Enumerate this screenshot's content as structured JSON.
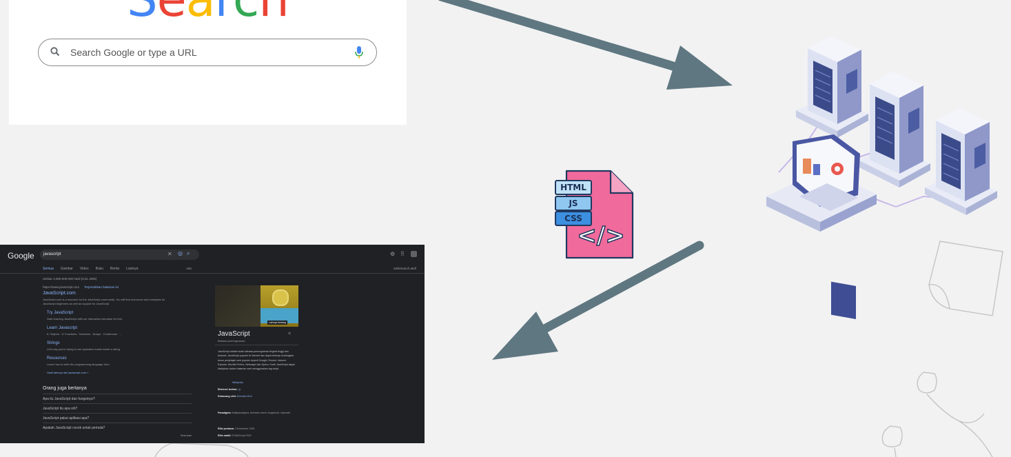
{
  "search_card": {
    "logo_letters": [
      {
        "ch": "S",
        "color": "#4285f4"
      },
      {
        "ch": "e",
        "color": "#ea4335"
      },
      {
        "ch": "a",
        "color": "#fbbc05"
      },
      {
        "ch": "r",
        "color": "#4285f4"
      },
      {
        "ch": "c",
        "color": "#34a853"
      },
      {
        "ch": "h",
        "color": "#ea4335"
      }
    ],
    "placeholder": "Search Google or type a URL"
  },
  "file_icon": {
    "tags": [
      "HTML",
      "JS",
      "CSS"
    ],
    "code_symbol": "</>",
    "colors": {
      "page": "#f06a9b",
      "tag": "#8fc7f0",
      "outline": "#20385f"
    }
  },
  "arrows": {
    "color": "#5f7780"
  },
  "results_screenshot": {
    "logo": "Google",
    "query": "javascript",
    "tabs": [
      "Semua",
      "Gambar",
      "Video",
      "Buku",
      "Berita",
      "Lainnya"
    ],
    "tools": "Alat",
    "safesearch": "SafeSearch aktif",
    "stats": "Sekitar 4.900.000.000 hasil (0,51 detik)",
    "result_url": "https://www.javascript.com",
    "result_translate": "Terjemahkan halaman ini",
    "result_title": "JavaScript.com",
    "result_snippet": "JavaScript.com is a resource for the JavaScript community. You will find resources and examples for JavaScript beginners as well as support for JavaScript.",
    "sitelinks": [
      {
        "title": "Try JavaScript",
        "desc": "Start learning JavaScript with our interactive simulator for free."
      },
      {
        "title": "Learn Javascript",
        "desc": "If, Objects · If, Functions · Numbers · Arrays · Constructor · ..."
      },
      {
        "title": "Strings",
        "desc": "Let's say you're trying to use quotation marks inside a string."
      },
      {
        "title": "Resources",
        "desc": "Learn how to write the programming language from"
      }
    ],
    "more_results": "Hasil lainnya dari javascript.com »",
    "paa_heading": "Orang juga bertanya",
    "paa_questions": [
      "Apa itu JavaScript dan fungsinya?",
      "JavaScript itu apa sih?",
      "JavaScript pakai aplikasi apa?",
      "Apakah JavaScript cocok untuk pemula?"
    ],
    "feedback": "Masukan",
    "kp_title": "JavaScript",
    "kp_subtitle": "Bahasa pemrograman",
    "kp_image_caption": "Lainnya tentang",
    "kp_desc": "JavaScript adalah suatu bahasa pemrograman tingkat tinggi dan dinamis. JavaScript populer di internet dan dapat bekerja di sebagian besar penjelajah web populer seperti Google Chrome, Internet Explorer, Mozilla Firefox, Netscape dan Opera. Kode JavaScript dapat disisipkan dalam halaman web menggunakan tag script.",
    "kp_source": "Wikipedia",
    "kp_facts": [
      {
        "k": "Ekstensi berkas:",
        "v": ".js"
      },
      {
        "k": "Dirancang oleh:",
        "v": "Brendan Eich"
      },
      {
        "k": "Paradigma:",
        "v": "Multiparadigma, berbasis event, fungsional, imperatif"
      },
      {
        "k": "Rilis perdana:",
        "v": "4 Desember 1995"
      },
      {
        "k": "Rilis stabil:",
        "v": "ECMAScript 2022"
      }
    ]
  }
}
